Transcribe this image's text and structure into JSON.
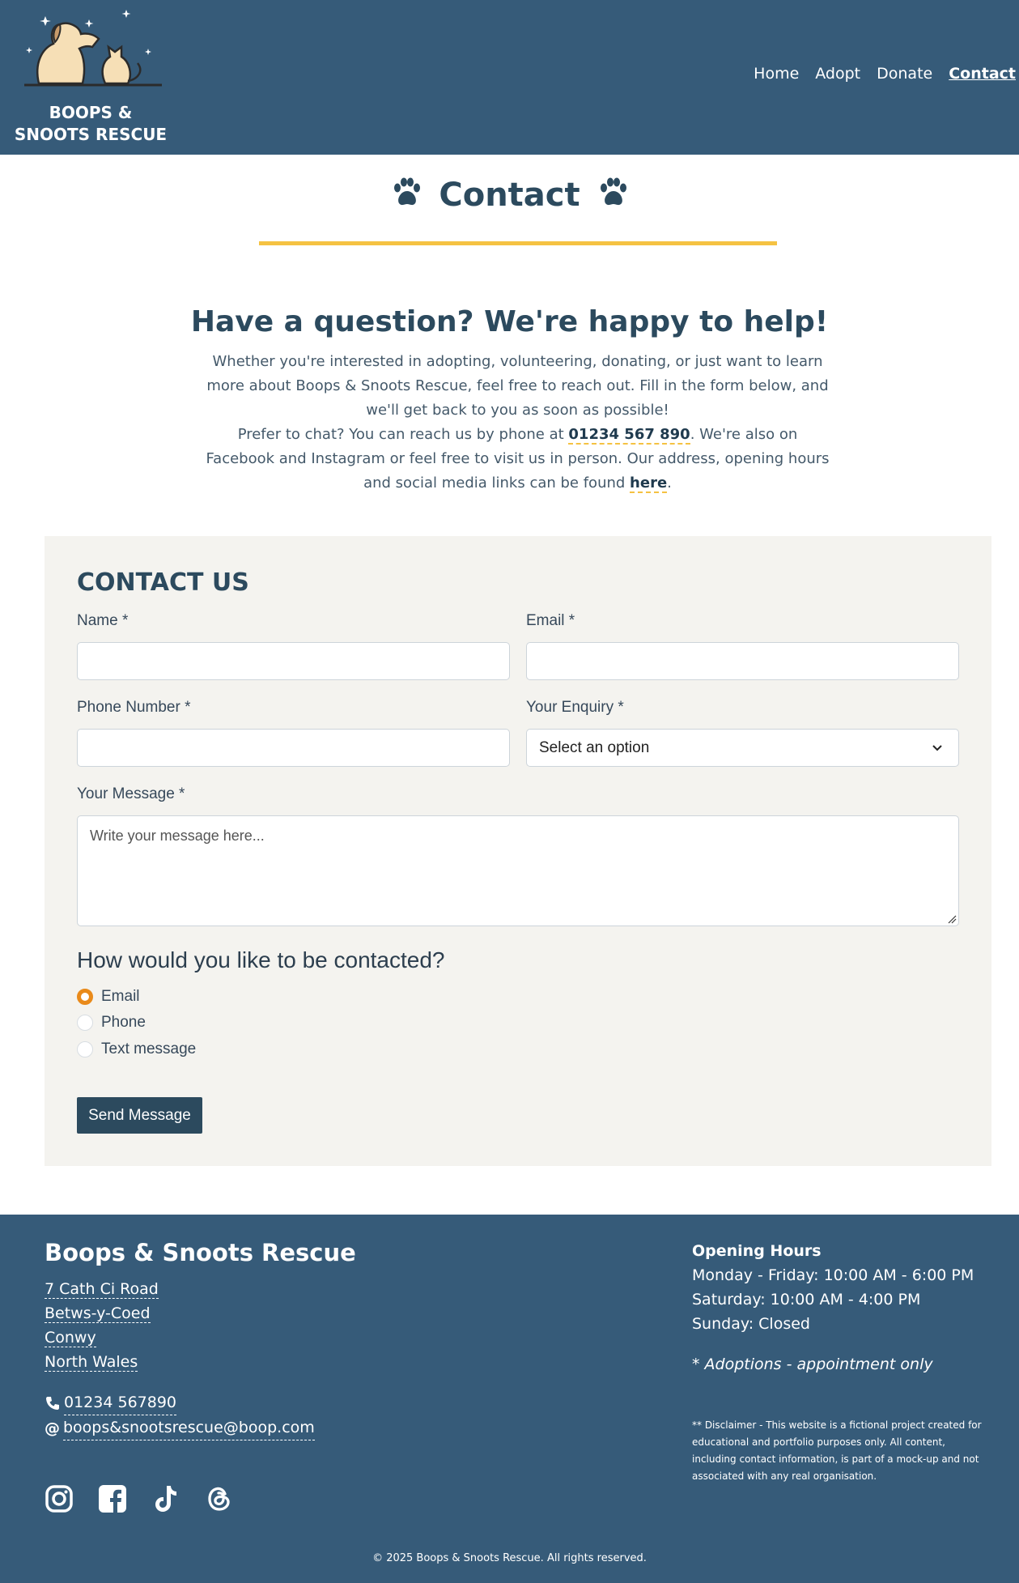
{
  "header": {
    "brand": "BOOPS & SNOOTS RESCUE",
    "nav": [
      {
        "label": "Home"
      },
      {
        "label": "Adopt"
      },
      {
        "label": "Donate"
      },
      {
        "label": "Contact",
        "active": true
      }
    ]
  },
  "page": {
    "title": "Contact"
  },
  "intro": {
    "heading": "Have a question? We're happy to help!",
    "p1": "Whether you're interested in adopting, volunteering, donating, or just want to learn more about Boops & Snoots Rescue, feel free to reach out. Fill in the form below, and we'll get back to you as soon as possible!",
    "p2_before": "Prefer to chat? You can reach us by phone at ",
    "phone": "01234 567 890",
    "p2_middle": ". We're also on Facebook and Instagram or feel free to visit us in person. Our address, opening hours and social media links can be found ",
    "here": "here",
    "p2_end": "."
  },
  "form": {
    "title": "CONTACT US",
    "name_label": "Name *",
    "email_label": "Email *",
    "phone_label": "Phone Number *",
    "enquiry_label": "Your Enquiry *",
    "enquiry_value": "Select an option",
    "message_label": "Your Message *",
    "message_placeholder": "Write your message here...",
    "contact_question": "How would you like to be contacted?",
    "options": [
      {
        "label": "Email",
        "selected": true
      },
      {
        "label": "Phone",
        "selected": false
      },
      {
        "label": "Text message",
        "selected": false
      }
    ],
    "submit": "Send Message"
  },
  "footer": {
    "name": "Boops & Snoots Rescue",
    "address": [
      "7 Cath Ci Road",
      "Betws-y-Coed",
      "Conwy",
      "North Wales"
    ],
    "phone": "01234 567890",
    "email": "boops&snootsrescue@boop.com",
    "hours_title": "Opening Hours",
    "hours": [
      "Monday - Friday: 10:00 AM - 6:00 PM",
      "Saturday: 10:00 AM - 4:00 PM",
      "Sunday: Closed"
    ],
    "appointment": "* Adoptions - appointment only",
    "disclaimer": "** Disclaimer - This website is a fictional project created for educational and portfolio purposes only. All content, including contact information, is part of a mock-up and not associated with any real organisation.",
    "copyright": "© 2025 Boops & Snoots Rescue. All rights reserved.",
    "social_icons": [
      "instagram-icon",
      "facebook-icon",
      "tiktok-icon",
      "threads-icon"
    ]
  },
  "colors": {
    "header_bg": "#365b79",
    "accent_yellow": "#f5c242",
    "radio_orange": "#e98a1a",
    "button_bg": "#2c4a5e",
    "form_bg": "#f4f3ef"
  }
}
